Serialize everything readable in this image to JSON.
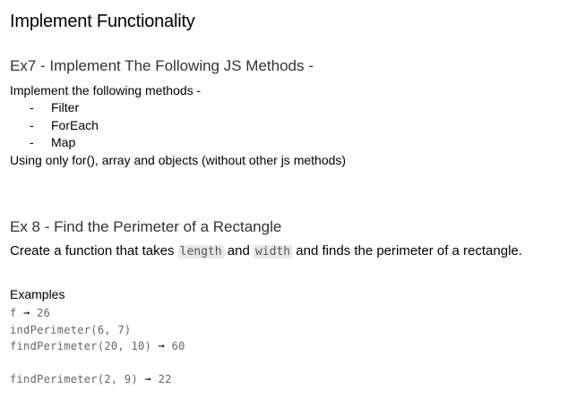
{
  "title": "Implement Functionality",
  "ex7": {
    "heading": "Ex7 - Implement The Following JS Methods -",
    "intro": "Implement the following methods -",
    "items": [
      {
        "bullet": "-",
        "label": "Filter"
      },
      {
        "bullet": "-",
        "label": "ForEach"
      },
      {
        "bullet": "-",
        "label": "Map"
      }
    ],
    "note": "Using only for(), array and objects (without other js methods)"
  },
  "ex8": {
    "heading": "Ex 8 - Find the Perimeter of a Rectangle",
    "desc_part1": "Create a function that takes ",
    "code_length": "length",
    "desc_and": " and ",
    "code_width": "width",
    "desc_part2": " and finds the perimeter of a rectangle.",
    "examples_label": "Examples",
    "examples": [
      {
        "call": "f",
        "arrow": "➞",
        "result": "26"
      },
      {
        "call": "indPerimeter(6, 7)",
        "arrow": "",
        "result": ""
      },
      {
        "call": "findPerimeter(20, 10)",
        "arrow": "➞",
        "result": "60"
      },
      {
        "call": "findPerimeter(2, 9)",
        "arrow": "➞",
        "result": "22"
      }
    ]
  }
}
